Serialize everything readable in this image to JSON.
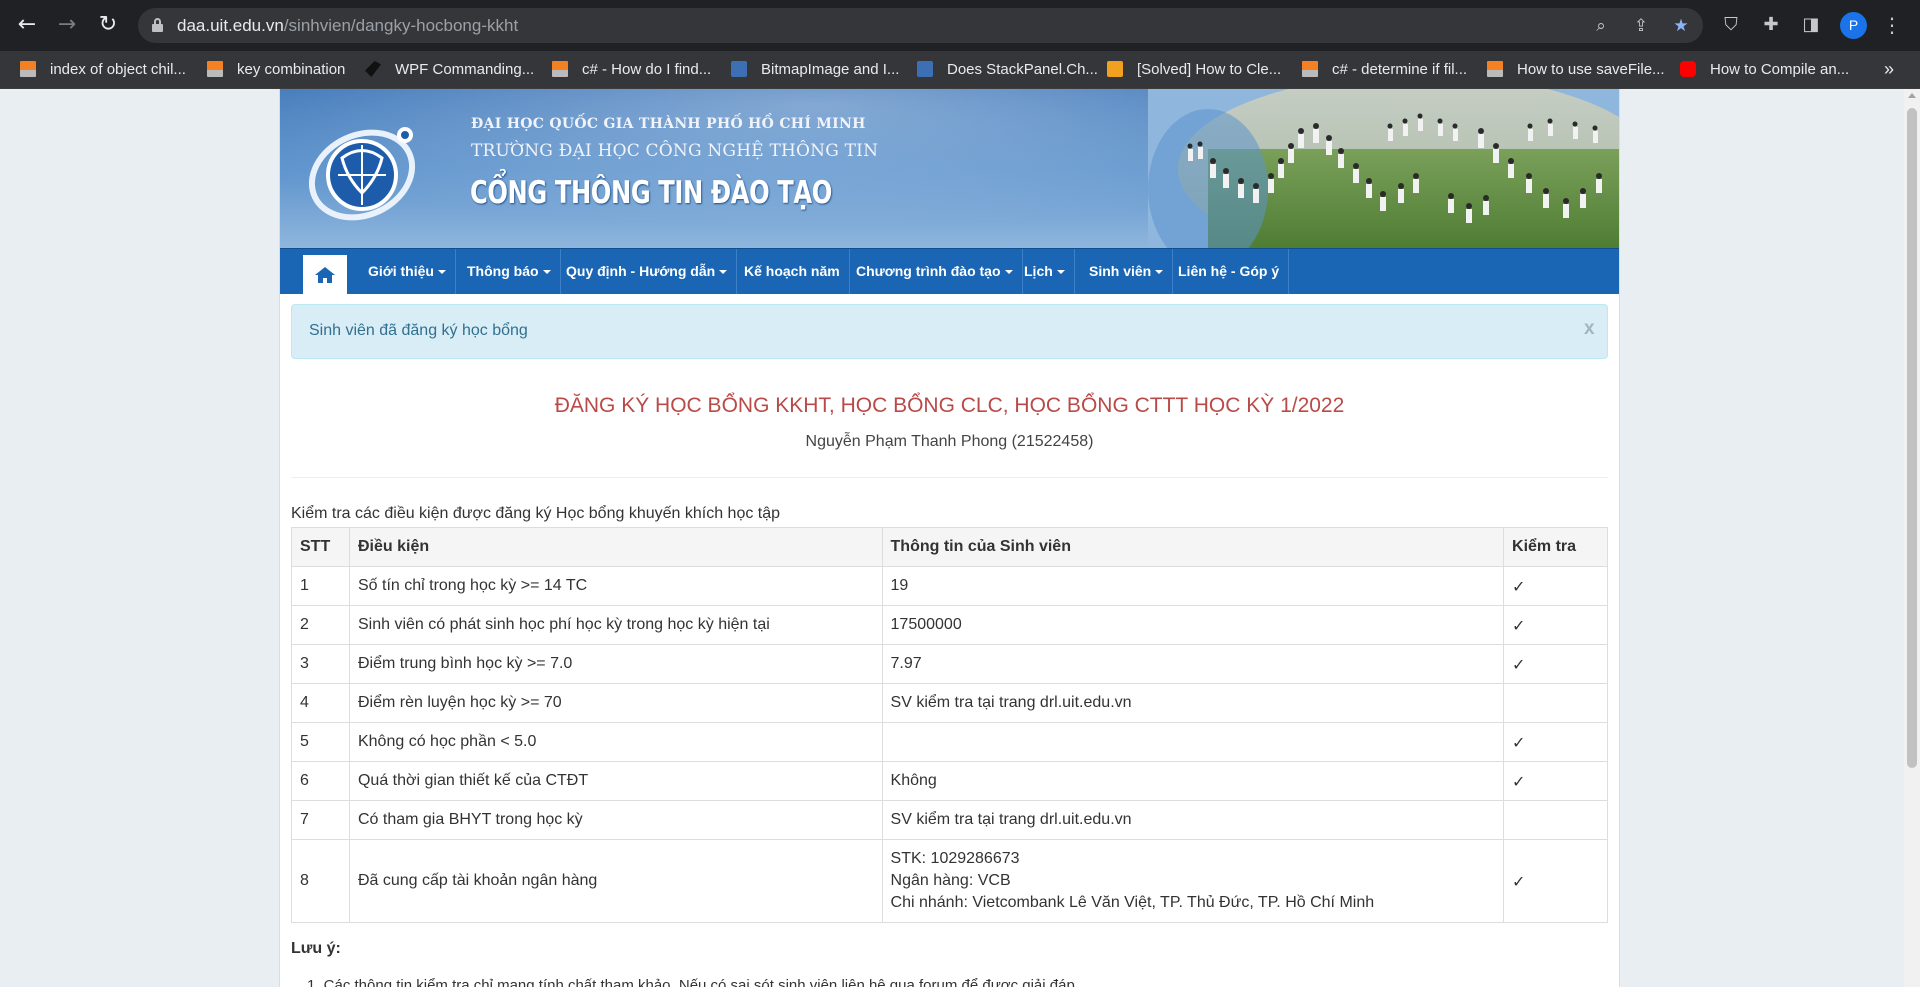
{
  "browser": {
    "url_host": "daa.uit.edu.vn",
    "url_path": "/sinhvien/dangky-hocbong-kkht",
    "profile_initial": "P",
    "bookmarks": [
      {
        "label": "index of object chil...",
        "icon": "stackoverflow-icon"
      },
      {
        "label": "key combination",
        "icon": "stackoverflow-icon"
      },
      {
        "label": "WPF Commanding...",
        "icon": "wpf-icon"
      },
      {
        "label": "c# - How do I find...",
        "icon": "stackoverflow-icon"
      },
      {
        "label": "BitmapImage and I...",
        "icon": "microsoft-docs-icon"
      },
      {
        "label": "Does StackPanel.Ch...",
        "icon": "microsoft-docs-icon"
      },
      {
        "label": "[Solved] How to Cle...",
        "icon": "solved-icon"
      },
      {
        "label": "c# - determine if fil...",
        "icon": "stackoverflow-icon"
      },
      {
        "label": "How to use saveFile...",
        "icon": "stackoverflow-icon"
      },
      {
        "label": "How to Compile an...",
        "icon": "youtube-icon"
      }
    ]
  },
  "banner": {
    "line1": "ĐẠI HỌC QUỐC GIA THÀNH PHỐ HỒ CHÍ MINH",
    "line2": "TRƯỜNG ĐẠI HỌC CÔNG NGHỆ THÔNG TIN",
    "line3": "CỔNG THÔNG TIN ĐÀO TẠO"
  },
  "menu": [
    {
      "label": "Giới thiệu",
      "dropdown": true
    },
    {
      "label": "Thông báo",
      "dropdown": true
    },
    {
      "label": "Quy định - Hướng dẫn",
      "dropdown": true
    },
    {
      "label": "Kế hoạch năm",
      "dropdown": false
    },
    {
      "label": "Chương trình đào tạo",
      "dropdown": true
    },
    {
      "label": "Lịch",
      "dropdown": true
    },
    {
      "label": "Sinh viên",
      "dropdown": true
    },
    {
      "label": "Liên hệ - Góp ý",
      "dropdown": false
    }
  ],
  "alert": {
    "text": "Sinh viên đã đăng ký học bổng",
    "close": "x"
  },
  "heading": "ĐĂNG KÝ HỌC BỔNG KKHT, HỌC BỔNG CLC, HỌC BỔNG CTTT HỌC KỲ 1/2022",
  "student": "Nguyễn Phạm Thanh Phong (21522458)",
  "caption": "Kiểm tra các điều kiện được đăng ký Học bổng khuyến khích học tập",
  "table": {
    "headers": [
      "STT",
      "Điều kiện",
      "Thông tin của Sinh viên",
      "Kiểm tra"
    ],
    "rows": [
      {
        "stt": "1",
        "condition": "Số tín chỉ trong học kỳ >= 14 TC",
        "info": [
          "19"
        ],
        "check": "✓"
      },
      {
        "stt": "2",
        "condition": "Sinh viên có phát sinh học phí học kỳ trong học kỳ hiện tại",
        "info": [
          "17500000"
        ],
        "check": "✓"
      },
      {
        "stt": "3",
        "condition": "Điểm trung bình học kỳ >= 7.0",
        "info": [
          "7.97"
        ],
        "check": "✓"
      },
      {
        "stt": "4",
        "condition": "Điểm rèn luyện học kỳ >= 70",
        "info": [
          "SV kiểm tra tại trang drl.uit.edu.vn"
        ],
        "check": ""
      },
      {
        "stt": "5",
        "condition": "Không có học phần < 5.0",
        "info": [
          ""
        ],
        "check": "✓"
      },
      {
        "stt": "6",
        "condition": "Quá thời gian thiết kế của CTĐT",
        "info": [
          "Không"
        ],
        "check": "✓"
      },
      {
        "stt": "7",
        "condition": "Có tham gia BHYT trong học kỳ",
        "info": [
          "SV kiểm tra tại trang drl.uit.edu.vn"
        ],
        "check": ""
      },
      {
        "stt": "8",
        "condition": "Đã cung cấp tài khoản ngân hàng",
        "info": [
          "STK: 1029286673",
          "Ngân hàng: VCB",
          "Chi nhánh: Vietcombank Lê Văn Việt, TP. Thủ Đức, TP. Hồ Chí Minh"
        ],
        "check": "✓"
      }
    ]
  },
  "notes": {
    "title": "Lưu ý:",
    "items": [
      "1. Các thông tin kiểm tra chỉ mang tính chất tham khảo. Nếu có sai sót sinh viên liên hệ qua forum để được giải đáp."
    ]
  },
  "colors": {
    "menu_bar": "#1a66b4",
    "heading": "#b94a48",
    "alert_bg": "#d9edf7",
    "alert_text": "#31708f"
  }
}
